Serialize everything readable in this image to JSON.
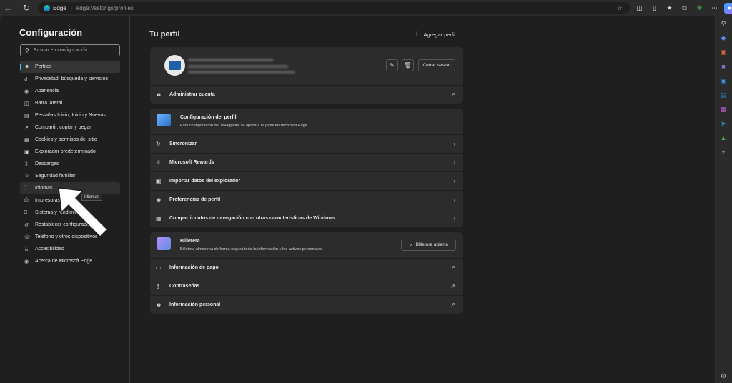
{
  "browser": {
    "brand": "Edge",
    "url": "edge://settings/profiles",
    "back_icon": "arrow-left-icon",
    "refresh_icon": "refresh-icon"
  },
  "nav": {
    "title": "Configuración",
    "search_placeholder": "Buscar en configuración",
    "items": [
      {
        "label": "Perfiles",
        "icon": "person-icon"
      },
      {
        "label": "Privacidad, búsqueda y servicios",
        "icon": "lock-icon"
      },
      {
        "label": "Apariencia",
        "icon": "palette-icon"
      },
      {
        "label": "Barra lateral",
        "icon": "sidebar-icon"
      },
      {
        "label": "Pestañas Inicio, Inicio y Nuevas",
        "icon": "tabs-icon"
      },
      {
        "label": "Compartir, copiar y pegar",
        "icon": "share-icon"
      },
      {
        "label": "Cookies y permisos del sitio",
        "icon": "cookie-icon"
      },
      {
        "label": "Explorador predeterminado",
        "icon": "browser-icon"
      },
      {
        "label": "Descargas",
        "icon": "download-icon"
      },
      {
        "label": "Seguridad familiar",
        "icon": "family-icon"
      },
      {
        "label": "Idiomas",
        "icon": "language-icon"
      },
      {
        "label": "Impresoras",
        "icon": "printer-icon"
      },
      {
        "label": "Sistema y rendimiento",
        "icon": "system-icon"
      },
      {
        "label": "Restablecer configuración",
        "icon": "reset-icon"
      },
      {
        "label": "Teléfono y otros dispositivos",
        "icon": "phone-icon"
      },
      {
        "label": "Accesibilidad",
        "icon": "accessibility-icon"
      },
      {
        "label": "Acerca de Microsoft Edge",
        "icon": "edge-icon"
      }
    ],
    "tooltip": "Idiomas"
  },
  "main": {
    "title": "Tu perfil",
    "add_profile": "Agregar perfil",
    "profile": {
      "sign_out": "Cerrar sesión",
      "manage_account": "Administrar cuenta"
    },
    "profile_settings": {
      "title": "Configuración del perfil",
      "description": "Esta configuración del navegador se aplica a tu perfil en Microsoft Edge",
      "rows": [
        "Sincronizar",
        "Microsoft Rewards",
        "Importar datos del explorador",
        "Preferencias de perfil",
        "Compartir datos de navegación con otras características de Windows"
      ]
    },
    "wallet": {
      "title": "Billetera",
      "description": "Billetera almacena de forma segura toda la información y los activos personales",
      "open_button": "Billetera abierta",
      "rows": [
        "Información de pago",
        "Contraseñas",
        "Información personal"
      ]
    }
  },
  "colors": {
    "accent": "#4cc2ff",
    "background": "#1f1f1f",
    "card": "#2c2c2c"
  }
}
